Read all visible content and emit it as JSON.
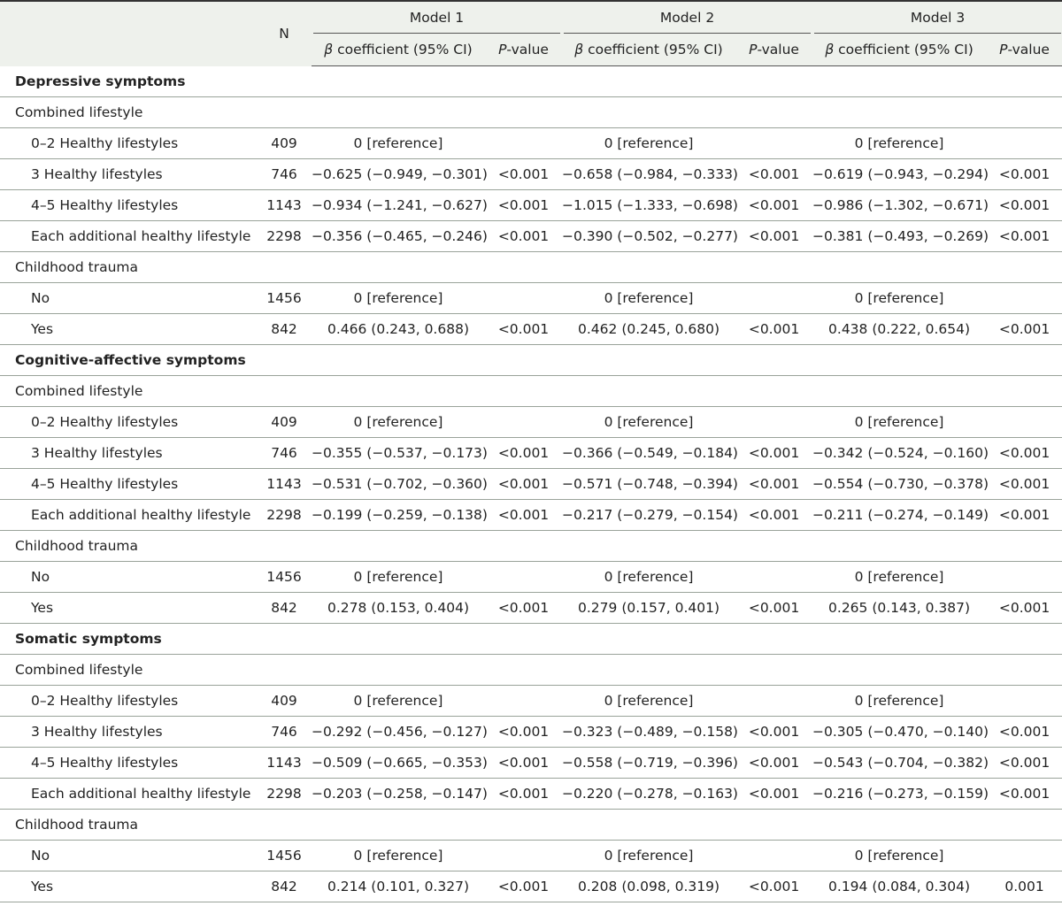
{
  "header": {
    "n_label": "N",
    "models": [
      "Model 1",
      "Model 2",
      "Model 3"
    ],
    "beta_label": "coefficient (95% CI)",
    "beta_symbol": "β",
    "p_italic": "P",
    "p_rest": "-value"
  },
  "sections": [
    {
      "title": "Depressive symptoms",
      "groups": [
        {
          "title": "Combined lifestyle",
          "rows": [
            {
              "label": "0–2 Healthy lifestyles",
              "n": "409",
              "m1": "0 [reference]",
              "p1": "",
              "m2": "0 [reference]",
              "p2": "",
              "m3": "0 [reference]",
              "p3": ""
            },
            {
              "label": "3 Healthy lifestyles",
              "n": "746",
              "m1": "−0.625 (−0.949, −0.301)",
              "p1": "<0.001",
              "m2": "−0.658 (−0.984, −0.333)",
              "p2": "<0.001",
              "m3": "−0.619 (−0.943, −0.294)",
              "p3": "<0.001"
            },
            {
              "label": "4–5 Healthy lifestyles",
              "n": "1143",
              "m1": "−0.934 (−1.241, −0.627)",
              "p1": "<0.001",
              "m2": "−1.015 (−1.333, −0.698)",
              "p2": "<0.001",
              "m3": "−0.986 (−1.302, −0.671)",
              "p3": "<0.001"
            },
            {
              "label": "Each additional healthy lifestyle",
              "n": "2298",
              "m1": "−0.356 (−0.465, −0.246)",
              "p1": "<0.001",
              "m2": "−0.390 (−0.502, −0.277)",
              "p2": "<0.001",
              "m3": "−0.381 (−0.493, −0.269)",
              "p3": "<0.001"
            }
          ]
        },
        {
          "title": "Childhood trauma",
          "rows": [
            {
              "label": "No",
              "n": "1456",
              "m1": "0 [reference]",
              "p1": "",
              "m2": "0 [reference]",
              "p2": "",
              "m3": "0 [reference]",
              "p3": ""
            },
            {
              "label": "Yes",
              "n": "842",
              "m1": "0.466 (0.243, 0.688)",
              "p1": "<0.001",
              "m2": "0.462 (0.245, 0.680)",
              "p2": "<0.001",
              "m3": "0.438 (0.222, 0.654)",
              "p3": "<0.001"
            }
          ]
        }
      ]
    },
    {
      "title": "Cognitive-affective symptoms",
      "groups": [
        {
          "title": "Combined lifestyle",
          "rows": [
            {
              "label": "0–2 Healthy lifestyles",
              "n": "409",
              "m1": "0 [reference]",
              "p1": "",
              "m2": "0 [reference]",
              "p2": "",
              "m3": "0 [reference]",
              "p3": ""
            },
            {
              "label": "3 Healthy lifestyles",
              "n": "746",
              "m1": "−0.355 (−0.537, −0.173)",
              "p1": "<0.001",
              "m2": "−0.366 (−0.549, −0.184)",
              "p2": "<0.001",
              "m3": "−0.342 (−0.524, −0.160)",
              "p3": "<0.001"
            },
            {
              "label": "4–5 Healthy lifestyles",
              "n": "1143",
              "m1": "−0.531 (−0.702, −0.360)",
              "p1": "<0.001",
              "m2": "−0.571 (−0.748, −0.394)",
              "p2": "<0.001",
              "m3": "−0.554 (−0.730, −0.378)",
              "p3": "<0.001"
            },
            {
              "label": "Each additional healthy lifestyle",
              "n": "2298",
              "m1": "−0.199 (−0.259, −0.138)",
              "p1": "<0.001",
              "m2": "−0.217 (−0.279, −0.154)",
              "p2": "<0.001",
              "m3": "−0.211 (−0.274, −0.149)",
              "p3": "<0.001"
            }
          ]
        },
        {
          "title": "Childhood trauma",
          "rows": [
            {
              "label": "No",
              "n": "1456",
              "m1": "0 [reference]",
              "p1": "",
              "m2": "0 [reference]",
              "p2": "",
              "m3": "0 [reference]",
              "p3": ""
            },
            {
              "label": "Yes",
              "n": "842",
              "m1": "0.278 (0.153, 0.404)",
              "p1": "<0.001",
              "m2": "0.279 (0.157, 0.401)",
              "p2": "<0.001",
              "m3": "0.265 (0.143, 0.387)",
              "p3": "<0.001"
            }
          ]
        }
      ]
    },
    {
      "title": "Somatic symptoms",
      "groups": [
        {
          "title": "Combined lifestyle",
          "rows": [
            {
              "label": "0–2 Healthy lifestyles",
              "n": "409",
              "m1": "0 [reference]",
              "p1": "",
              "m2": "0 [reference]",
              "p2": "",
              "m3": "0 [reference]",
              "p3": ""
            },
            {
              "label": "3 Healthy lifestyles",
              "n": "746",
              "m1": "−0.292 (−0.456, −0.127)",
              "p1": "<0.001",
              "m2": "−0.323 (−0.489, −0.158)",
              "p2": "<0.001",
              "m3": "−0.305 (−0.470, −0.140)",
              "p3": "<0.001"
            },
            {
              "label": "4–5 Healthy lifestyles",
              "n": "1143",
              "m1": "−0.509 (−0.665, −0.353)",
              "p1": "<0.001",
              "m2": "−0.558 (−0.719, −0.396)",
              "p2": "<0.001",
              "m3": "−0.543 (−0.704, −0.382)",
              "p3": "<0.001"
            },
            {
              "label": "Each additional healthy lifestyle",
              "n": "2298",
              "m1": "−0.203 (−0.258, −0.147)",
              "p1": "<0.001",
              "m2": "−0.220 (−0.278, −0.163)",
              "p2": "<0.001",
              "m3": "−0.216 (−0.273, −0.159)",
              "p3": "<0.001"
            }
          ]
        },
        {
          "title": "Childhood trauma",
          "rows": [
            {
              "label": "No",
              "n": "1456",
              "m1": "0 [reference]",
              "p1": "",
              "m2": "0 [reference]",
              "p2": "",
              "m3": "0 [reference]",
              "p3": ""
            },
            {
              "label": "Yes",
              "n": "842",
              "m1": "0.214 (0.101, 0.327)",
              "p1": "<0.001",
              "m2": "0.208 (0.098, 0.319)",
              "p2": "<0.001",
              "m3": "0.194 (0.084, 0.304)",
              "p3": "0.001"
            }
          ]
        }
      ]
    }
  ]
}
